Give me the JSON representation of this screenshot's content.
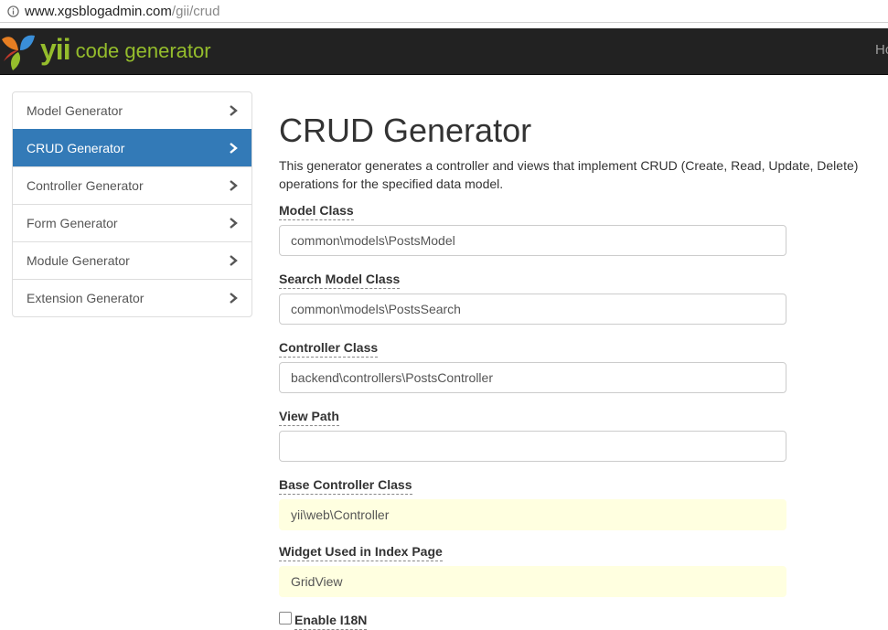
{
  "browser": {
    "url_host": "www.xgsblogadmin.com",
    "url_path": "/gii/crud"
  },
  "navbar": {
    "logo_yii": "yii",
    "logo_text": "code generator",
    "right_text": "Ho"
  },
  "sidebar": {
    "items": [
      {
        "label": "Model Generator"
      },
      {
        "label": "CRUD Generator"
      },
      {
        "label": "Controller Generator"
      },
      {
        "label": "Form Generator"
      },
      {
        "label": "Module Generator"
      },
      {
        "label": "Extension Generator"
      }
    ],
    "active_index": 1
  },
  "main": {
    "title": "CRUD Generator",
    "description": "This generator generates a controller and views that implement CRUD (Create, Read, Update, Delete) operations for the specified data model.",
    "fields": [
      {
        "label": "Model Class",
        "value": "common\\models\\PostsModel"
      },
      {
        "label": "Search Model Class",
        "value": "common\\models\\PostsSearch"
      },
      {
        "label": "Controller Class",
        "value": "backend\\controllers\\PostsController"
      },
      {
        "label": "View Path",
        "value": ""
      },
      {
        "label": "Base Controller Class",
        "value": "yii\\web\\Controller"
      },
      {
        "label": "Widget Used in Index Page",
        "value": "GridView"
      }
    ],
    "checkbox_label": "Enable I18N"
  },
  "colors": {
    "navbar_bg": "#222222",
    "brand_green": "#95bd2c",
    "active_blue": "#337ab7",
    "sticky_yellow": "#ffffe0"
  }
}
